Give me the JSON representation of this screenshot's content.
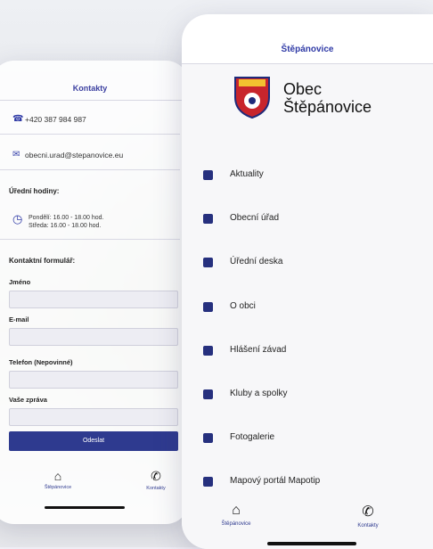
{
  "left_screen": {
    "title": "Kontakty",
    "phone": "+420 387 984 987",
    "email": "obecni.urad@stepanovice.eu",
    "office_hours_heading": "Úřední hodiny:",
    "hours_line1": "Pondělí: 16.00 - 18.00 hod.",
    "hours_line2": "Středa: 16.00 - 18.00 hod.",
    "form_heading": "Kontaktní formulář:",
    "fields": [
      "Jméno",
      "E-mail",
      "Telefon (Nepovinné)",
      "Vaše zpráva"
    ],
    "send_label": "Odeslat",
    "nav": [
      {
        "label": "Štěpánovice",
        "icon": "home-icon"
      },
      {
        "label": "Kontakty",
        "icon": "phone-icon"
      }
    ]
  },
  "main_screen": {
    "title": "Štěpánovice",
    "brand_line1": "Obec",
    "brand_line2": "Štěpánovice",
    "menu": [
      {
        "label": "Aktuality",
        "icon": "news-icon"
      },
      {
        "label": "Obecní úřad",
        "icon": "building-icon"
      },
      {
        "label": "Úřední deska",
        "icon": "board-icon"
      },
      {
        "label": "O obci",
        "icon": "info-icon"
      },
      {
        "label": "Hlášení závad",
        "icon": "megaphone-icon"
      },
      {
        "label": "Kluby a spolky",
        "icon": "clubs-icon"
      },
      {
        "label": "Fotogalerie",
        "icon": "gallery-icon"
      },
      {
        "label": "Mapový portál Mapotip",
        "icon": "map-icon"
      }
    ],
    "nav": [
      {
        "label": "Štěpánovice",
        "icon": "home-icon"
      },
      {
        "label": "Kontakty",
        "icon": "phone-icon"
      }
    ]
  },
  "colors": {
    "accent": "#2f3aa6",
    "button": "#2e3a8f",
    "background": "#f1f0f7"
  }
}
